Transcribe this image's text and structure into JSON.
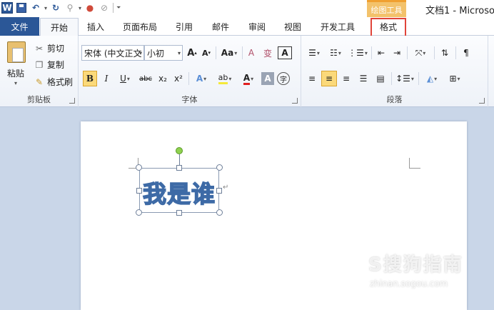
{
  "titlebar": {
    "app_icon": "W",
    "context_tab_group": "绘图工具",
    "document_title": "文档1 - Microso",
    "colors": {
      "context_header": "#f3c26b",
      "file_tab": "#2b5797",
      "highlight_box": "#e0443a"
    }
  },
  "tabs": [
    {
      "label": "文件"
    },
    {
      "label": "开始"
    },
    {
      "label": "插入"
    },
    {
      "label": "页面布局"
    },
    {
      "label": "引用"
    },
    {
      "label": "邮件"
    },
    {
      "label": "审阅"
    },
    {
      "label": "视图"
    },
    {
      "label": "开发工具"
    },
    {
      "label": "格式"
    }
  ],
  "ribbon": {
    "clipboard": {
      "paste": "粘贴",
      "cut": "剪切",
      "copy": "复制",
      "format_painter": "格式刷",
      "label": "剪贴板"
    },
    "font": {
      "font_name": "宋体 (中文正文",
      "font_size": "小初",
      "grow": "A",
      "shrink": "A",
      "change_case": "Aa",
      "clear_format": "A",
      "pinyin": "变",
      "char_border": "A",
      "bold": "B",
      "italic": "I",
      "underline": "U",
      "strikethrough": "abc",
      "subscript": "x₂",
      "superscript": "x²",
      "text_effect": "A",
      "highlight": "ab",
      "font_color": "A",
      "char_shading": "A",
      "enclose": "字",
      "label": "字体"
    },
    "paragraph": {
      "label": "段落"
    }
  },
  "document": {
    "wordart_text": "我是谁",
    "para_mark": "↵"
  },
  "watermark": {
    "text": "S搜狗指南",
    "url": "zhinan.sogou.com"
  }
}
